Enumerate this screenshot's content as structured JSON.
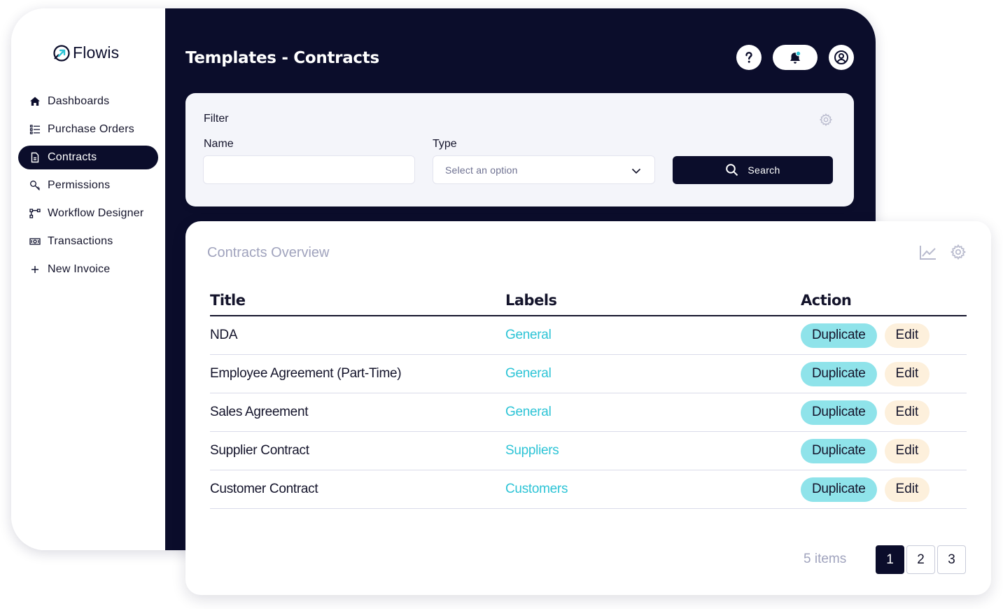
{
  "app": {
    "name": "Flowis"
  },
  "sidebar": {
    "items": [
      {
        "label": "Dashboards",
        "icon": "home-icon",
        "active": false
      },
      {
        "label": "Purchase Orders",
        "icon": "list-icon",
        "active": false
      },
      {
        "label": "Contracts",
        "icon": "document-icon",
        "active": true
      },
      {
        "label": "Permissions",
        "icon": "key-icon",
        "active": false
      },
      {
        "label": "Workflow Designer",
        "icon": "workflow-icon",
        "active": false
      },
      {
        "label": "Transactions",
        "icon": "cash-icon",
        "active": false
      },
      {
        "label": "New Invoice",
        "icon": "plus-icon",
        "active": false
      }
    ]
  },
  "header": {
    "title": "Templates - Contracts",
    "icons": [
      "help-icon",
      "bell-icon",
      "user-icon"
    ]
  },
  "filter": {
    "title": "Filter",
    "name_label": "Name",
    "name_value": "",
    "type_label": "Type",
    "type_placeholder": "Select an option",
    "search_label": "Search"
  },
  "overview": {
    "title": "Contracts Overview",
    "columns": [
      "Title",
      "Labels",
      "Action"
    ],
    "rows": [
      {
        "title": "NDA",
        "label": "General",
        "duplicate": "Duplicate",
        "edit": "Edit"
      },
      {
        "title": "Employee Agreement (Part-Time)",
        "label": "General",
        "duplicate": "Duplicate",
        "edit": "Edit"
      },
      {
        "title": "Sales Agreement",
        "label": "General",
        "duplicate": "Duplicate",
        "edit": "Edit"
      },
      {
        "title": "Supplier Contract",
        "label": "Suppliers",
        "duplicate": "Duplicate",
        "edit": "Edit"
      },
      {
        "title": "Customer Contract",
        "label": "Customers",
        "duplicate": "Duplicate",
        "edit": "Edit"
      }
    ],
    "items_count": "5 items",
    "pages": [
      "1",
      "2",
      "3"
    ],
    "current_page": "1"
  },
  "colors": {
    "navy": "#0b0d2b",
    "accent_teal": "#2ec4d6",
    "duplicate_bg": "#8fe3ea",
    "edit_bg": "#fdf0dc",
    "muted": "#a0a3bd"
  }
}
